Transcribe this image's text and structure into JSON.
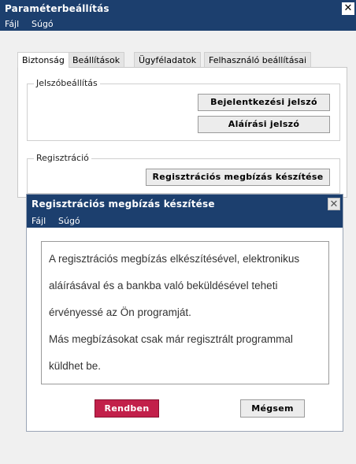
{
  "main_window": {
    "title": "Paraméterbeállítás",
    "close_glyph": "✕",
    "menu": [
      "Fájl",
      "Súgó"
    ],
    "tabs": [
      "Biztonság",
      "Beállítások",
      "Ügyféladatok",
      "Felhasználó beállításai"
    ],
    "active_tab": "Biztonság",
    "password_group": {
      "legend": "Jelszóbeállítás",
      "buttons": [
        "Bejelentkezési jelszó",
        "Aláírási jelszó"
      ]
    },
    "registration_group": {
      "legend": "Regisztráció",
      "button": "Regisztrációs megbízás készítése"
    }
  },
  "dialog": {
    "title": "Regisztrációs megbízás készítése",
    "close_glyph": "✕",
    "menu": [
      "Fájl",
      "Súgó"
    ],
    "message_lines": [
      "A regisztrációs megbízás elkészítésével, elektronikus",
      "aláírásával és a bankba való beküldésével teheti",
      "érvényessé az Ön programját.",
      "Más megbízásokat csak már regisztrált programmal",
      "küldhet be."
    ],
    "ok_label": "Rendben",
    "cancel_label": "Mégsem"
  },
  "colors": {
    "titlebar": "#1c3f6e",
    "ok_button": "#c2204a"
  }
}
